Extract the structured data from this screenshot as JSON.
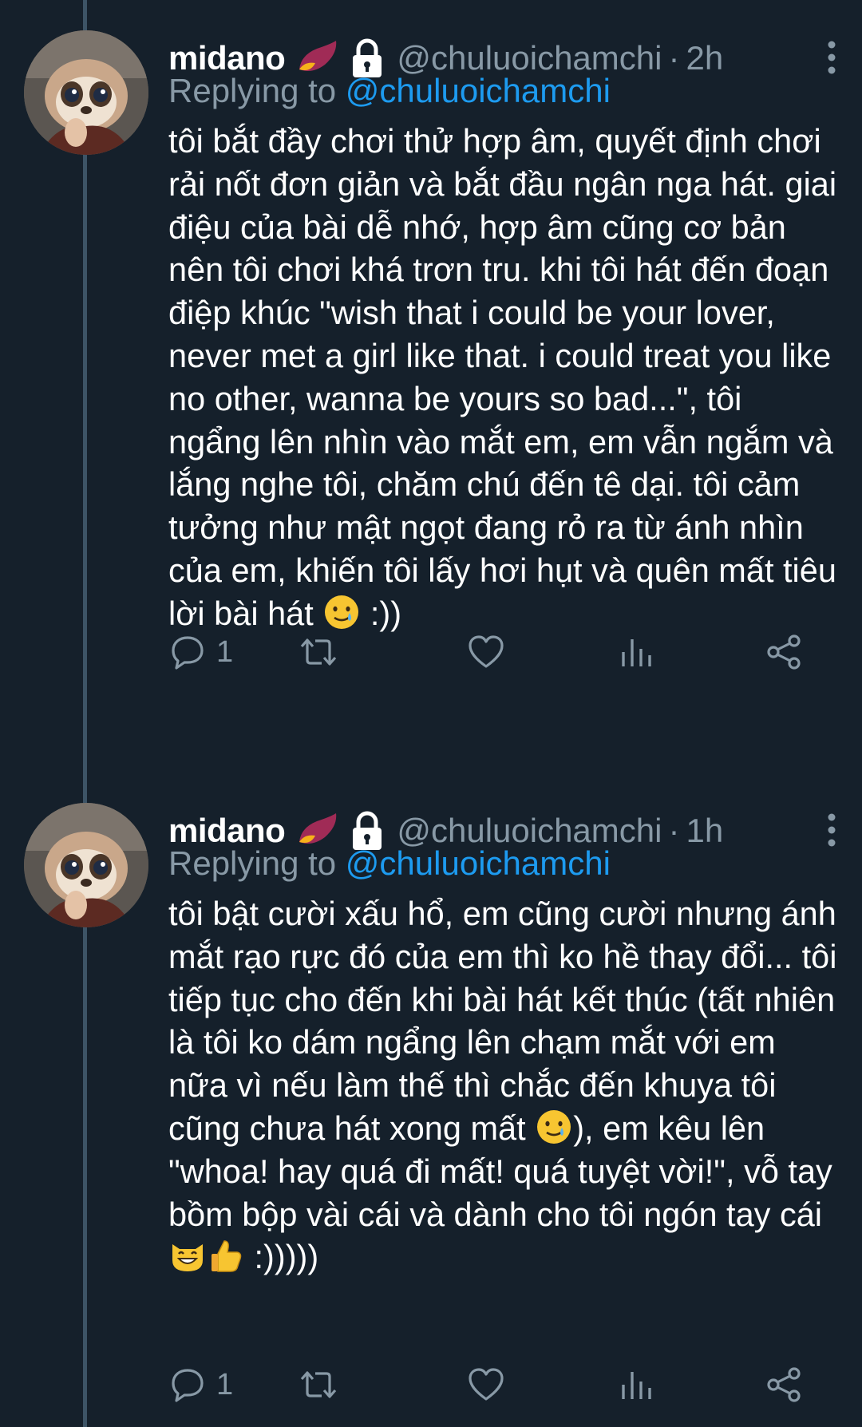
{
  "colors": {
    "background": "#15202b",
    "text": "#ffffff",
    "muted": "#8899a6",
    "link": "#1d9bf0",
    "thread_line": "#3d5466"
  },
  "tweets": [
    {
      "name": "midano",
      "name_emoji": "sweet-potato-icon",
      "protected_icon": "lock-icon",
      "handle": "@chuluoichamchi",
      "separator": "·",
      "time": "2h",
      "replying_prefix": "Replying to ",
      "replying_to": "@chuluoichamchi",
      "text": "tôi bắt đầy chơi thử hợp âm, quyết định chơi rải nốt đơn giản và bắt đầu ngân nga hát. giai điệu của bài dễ nhớ, hợp âm cũng cơ bản nên tôi chơi khá trơn tru. khi tôi hát đến đoạn điệp khúc \"wish that i could be your lover, never met a girl like that. i could treat you like no other, wanna be yours so bad...\", tôi ngẩng lên nhìn vào mắt em, em vẫn ngắm và lắng nghe tôi, chăm chú đến tê dại. tôi cảm tưởng như mật ngọt đang rỏ ra từ ánh nhìn của em, khiến tôi lấy hơi hụt và quên mất tiêu lời bài hát ",
      "text_tail": " :))",
      "replies": "1"
    },
    {
      "name": "midano",
      "name_emoji": "sweet-potato-icon",
      "protected_icon": "lock-icon",
      "handle": "@chuluoichamchi",
      "separator": "·",
      "time": "1h",
      "replying_prefix": "Replying to ",
      "replying_to": "@chuluoichamchi",
      "text": "tôi bật cười xấu hổ, em cũng cười nhưng ánh mắt rạo rực đó của em thì ko hề thay đổi... tôi tiếp tục cho đến khi bài hát kết thúc (tất nhiên là tôi ko dám ngẩng lên chạm mắt với em nữa vì nếu làm thế thì chắc đến khuya tôi cũng chưa hát xong mất ",
      "text_mid": "), em kêu lên \"whoa! hay quá đi mất! quá tuyệt vời!\", vỗ tay bồm bộp vài cái và dành cho tôi ngón tay cái ",
      "text_tail": " :)))))",
      "replies": "1"
    }
  ]
}
